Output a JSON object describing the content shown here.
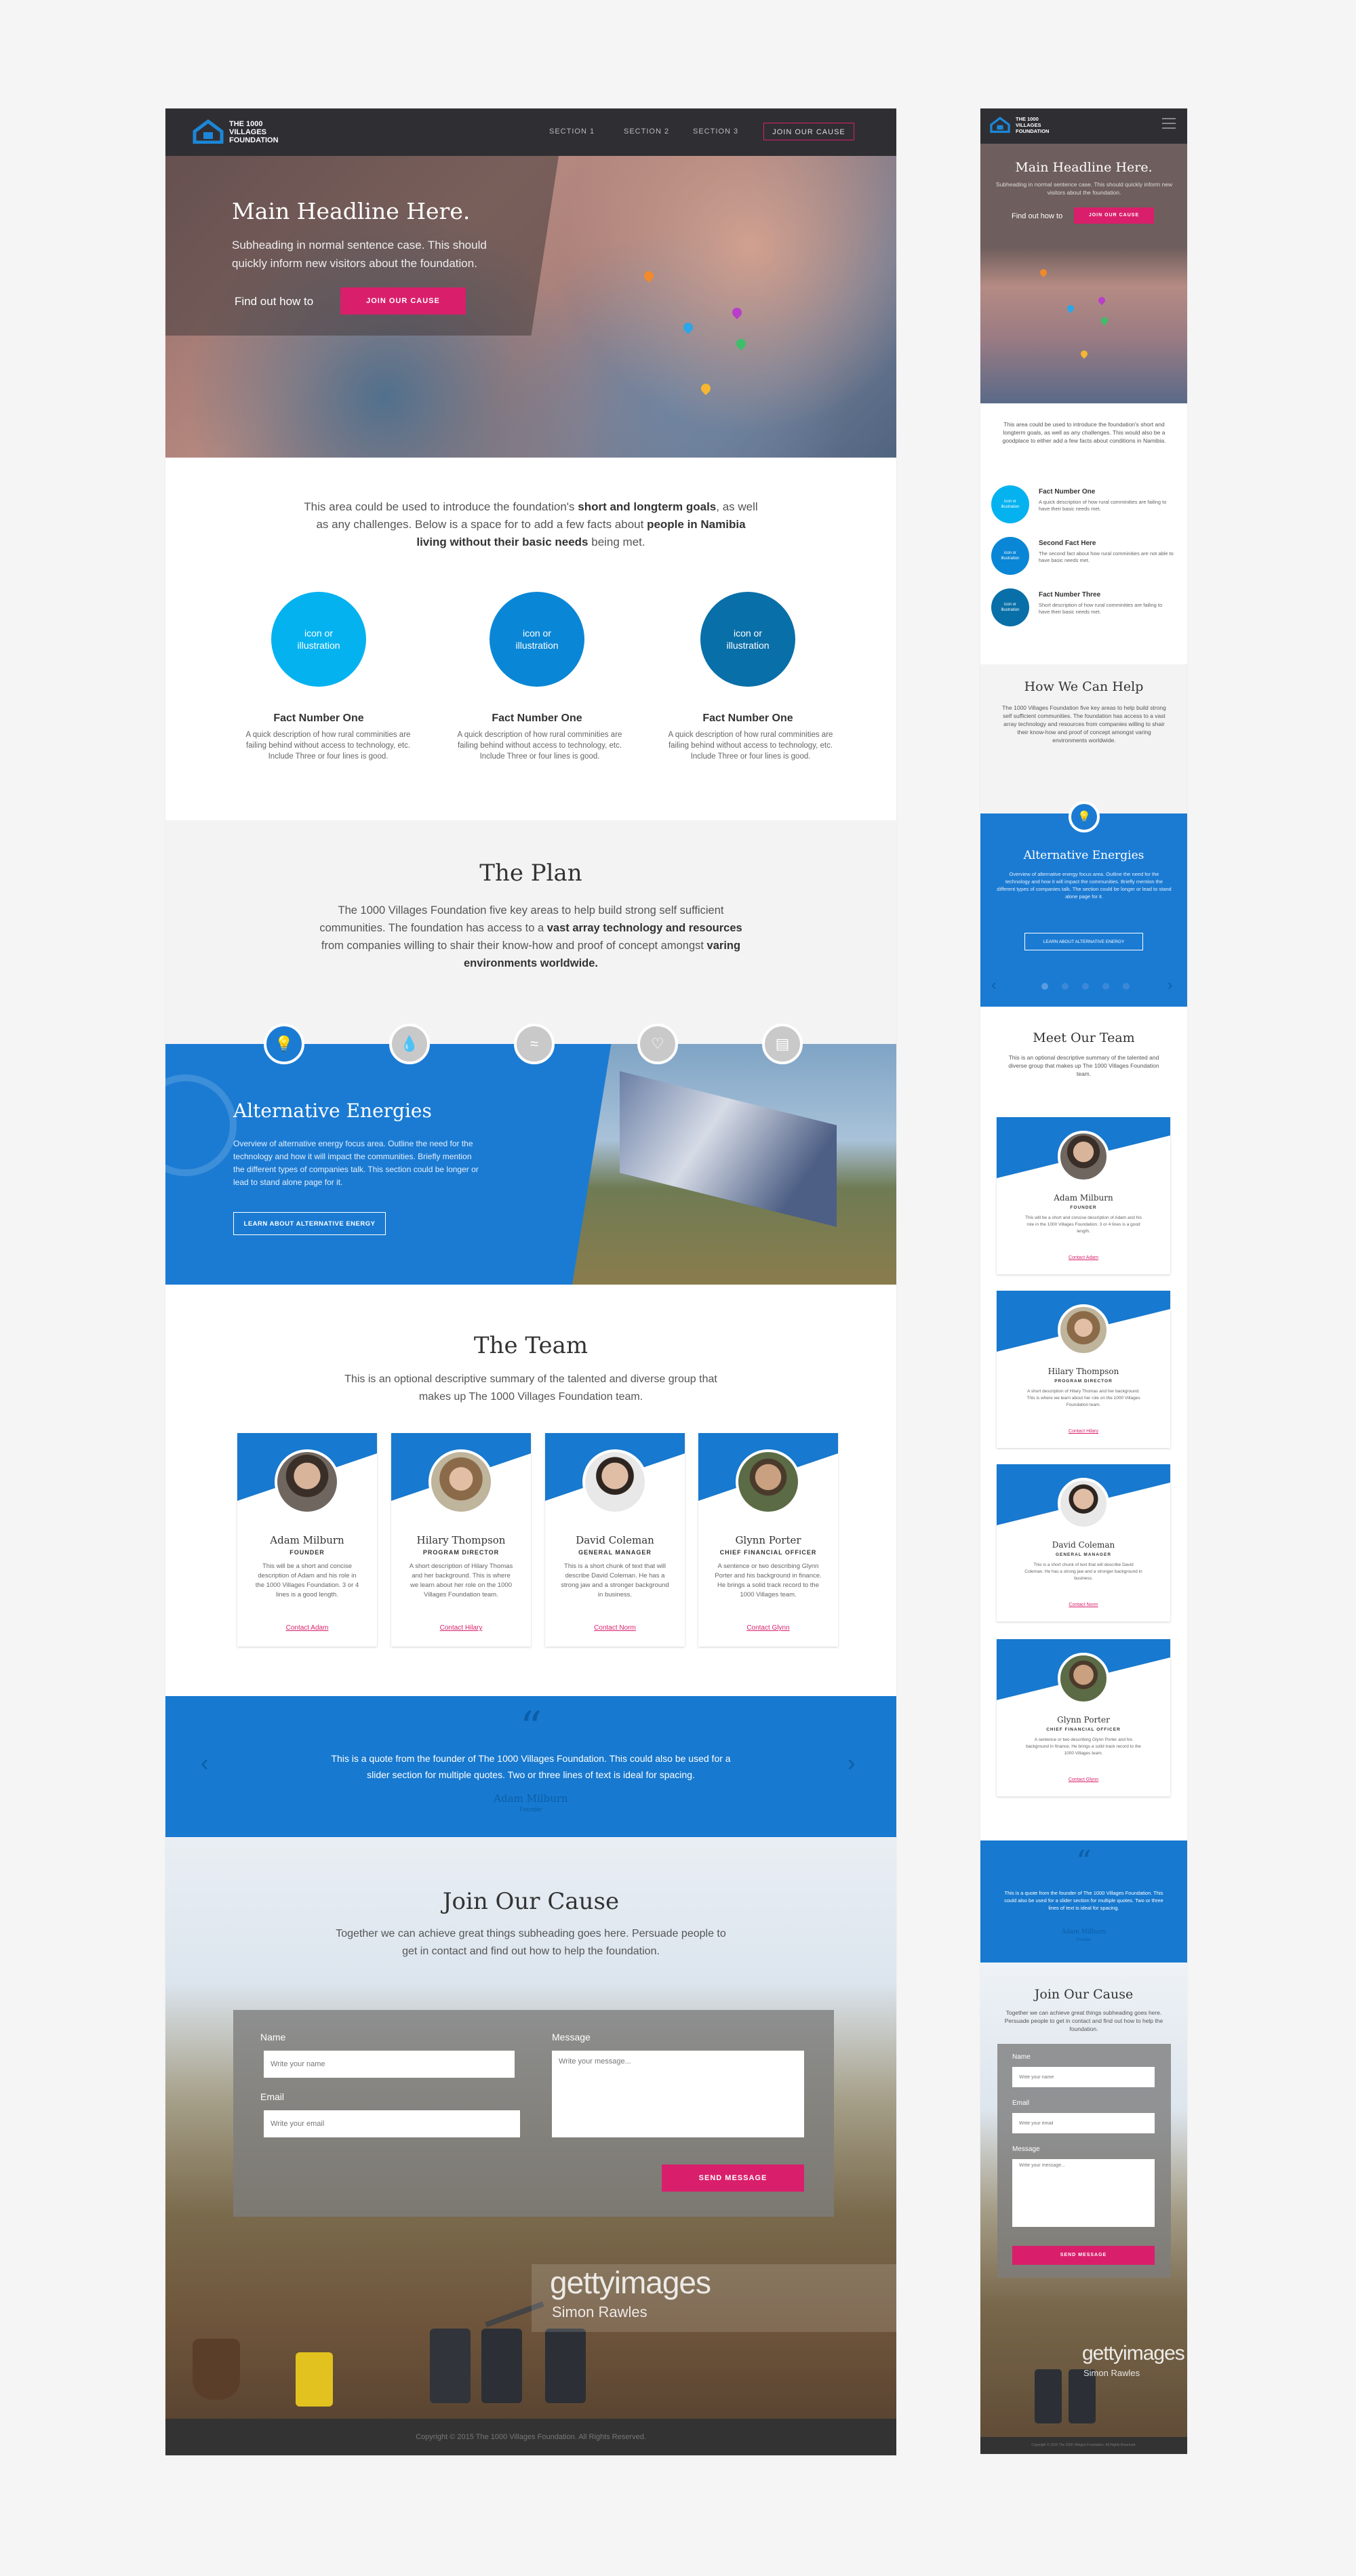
{
  "desktop": {
    "nav": {
      "logo_line1": "THE 1000",
      "logo_line2": "VILLAGES",
      "logo_line3": "FOUNDATION",
      "links": [
        "SECTION 1",
        "SECTION 2",
        "SECTION 3"
      ],
      "cta": "JOIN OUR CAUSE"
    },
    "hero": {
      "headline": "Main Headline Here.",
      "subheading": "Subheading in normal sentence case. This should quickly inform new visitors about the foundation.",
      "find_out": "Find out how to",
      "cta": "JOIN OUR CAUSE"
    },
    "intro": {
      "p1": "This area could be used to introduce the foundation's ",
      "b1": "short and longterm goals",
      "p2": ", as well as any challenges. Below is a space for to add a few facts about ",
      "b2": "people in Namibia living without their basic needs",
      "p3": " being met."
    },
    "facts": [
      {
        "icon": "icon or illustration",
        "title": "Fact Number One",
        "desc": "A quick description of how rural comminities are failing behind without access to technology, etc. Include Three or four lines is good.",
        "color": "#05b2f0"
      },
      {
        "icon": "icon or illustration",
        "title": "Fact Number One",
        "desc": "A quick description of how rural comminities are failing behind without access to technology, etc. Include Three or four lines is good.",
        "color": "#0a86d6"
      },
      {
        "icon": "icon or illustration",
        "title": "Fact Number One",
        "desc": "A quick description of how rural comminities are failing behind without access to technology, etc. Include Three or four lines is good.",
        "color": "#096fa8"
      }
    ],
    "plan": {
      "title": "The Plan",
      "p1": "The 1000 Villages Foundation five key areas to help build strong self sufficient communities. The foundation has access to a ",
      "b1": "vast array technology and resources",
      "p2": " from companies willing to shair their know-how and proof of concept amongst ",
      "b2": "varing environments worldwide."
    },
    "alt_energy": {
      "title": "Alternative Energies",
      "desc": "Overview of alternative energy focus area. Outline the need for the technology and how it will impact the communities. Briefly mention the different types of companies talk. This section could be longer or lead to stand alone page for it.",
      "button": "LEARN ABOUT ALTERNATIVE ENERGY"
    },
    "team": {
      "title": "The Team",
      "subtitle": "This is an optional descriptive summary of the talented and diverse group that makes up The 1000 Villages Foundation team.",
      "members": [
        {
          "name": "Adam Milburn",
          "role": "FOUNDER",
          "desc": "This will be a short and concise description of Adam and his role in the 1000 Villages Foundation. 3 or 4 lines is a good length.",
          "link": "Contact Adam"
        },
        {
          "name": "Hilary Thompson",
          "role": "PROGRAM DIRECTOR",
          "desc": "A short description of Hilary Thomas and her background. This is where we learn about her role on the 1000 Villages Foundation team.",
          "link": "Contact Hilary"
        },
        {
          "name": "David Coleman",
          "role": "GENERAL MANAGER",
          "desc": "This is a short chunk of text that will describe David Coleman. He has a strong jaw and a stronger background in business.",
          "link": "Contact Norm"
        },
        {
          "name": "Glynn Porter",
          "role": "CHIEF FINANCIAL OFFICER",
          "desc": "A sentence or two describing Glynn Porter and his background in finance. He brings a solid track record to the 1000 Villages team.",
          "link": "Contact Glynn"
        }
      ]
    },
    "quote": {
      "mark": "“",
      "text": "This is a quote from the founder of The 1000 Villages Foundation. This could also be used for a slider section for multiple quotes. Two or three lines of text is ideal for spacing.",
      "author": "Adam Milburn",
      "role": "Founder"
    },
    "join": {
      "title": "Join Our Cause",
      "subtitle": "Together we can achieve great things subheading goes here. Persuade people to get in contact and find out how to help the foundation.",
      "name_label": "Name",
      "name_placeholder": "Write your name",
      "email_label": "Email",
      "email_placeholder": "Write your email",
      "message_label": "Message",
      "message_placeholder": "Write your message...",
      "send": "SEND MESSAGE",
      "watermark": "gettyimages",
      "watermark_credit": "Simon Rawles"
    },
    "footer": "Copyright © 2015 The 1000 Villages Foundation. All Rights Reserved."
  },
  "mobile": {
    "logo_line1": "THE 1000",
    "logo_line2": "VILLAGES",
    "logo_line3": "FOUNDATION",
    "hero": {
      "headline": "Main Headline Here.",
      "subheading": "Subheading in normal sentence case. This should quickly inform new visitors about the foundation.",
      "find_out": "Find out how to",
      "cta": "JOIN OUR CAUSE"
    },
    "intro": "This area could be used to introduce the foundation's short and longterm goals, as well as any challenges. This would also be a goodplace to either add a few facts about conditions in Namibia.",
    "facts": [
      {
        "icon": "icon or illustration",
        "title": "Fact Number One",
        "desc": "A quick description of how rural comminities are failing to have their basic needs met."
      },
      {
        "icon": "icon or illustration",
        "title": "Second Fact Here",
        "desc": "The second fact about how rural comminities are not able to have basic needs met."
      },
      {
        "icon": "icon or illustration",
        "title": "Fact Number Three",
        "desc": "Short description of how rural comminities are failing to have their basic needs met."
      }
    ],
    "help": {
      "title": "How We Can Help",
      "text": "The 1000 Villages Foundation five key areas to help build strong self sufficient communities. The foundation has access to a vast array technology and resources from companies willing to shair their know-how and proof of concept amongst varing environments worldwide."
    },
    "alt": {
      "title": "Alternative Energies",
      "desc": "Overview of alternative energy focus area. Outline the need for the technology and how it will impact the communities. Briefly mention the different types of companies talk. The section could be longer or lead to stand alone page for it.",
      "button": "LEARN ABOUT ALTERNATIVE ENERGY"
    },
    "team": {
      "title": "Meet Our Team",
      "subtitle": "This is an optional descriptive summary of the talented and diverse group that makes up The 1000 Villages Foundation team.",
      "members": [
        {
          "name": "Adam Milburn",
          "role": "FOUNDER",
          "desc": "This will be a short and concise description of Adam and his role in the 1000 Villages Foundation. 3 or 4 lines is a good length.",
          "link": "Contact Adam"
        },
        {
          "name": "Hilary Thompson",
          "role": "PROGRAM DIRECTOR",
          "desc": "A short description of Hilary Thomas and her background. This is where we learn about her role on the 1000 Villages Foundation team.",
          "link": "Contact Hilary"
        },
        {
          "name": "David Coleman",
          "role": "GENERAL MANAGER",
          "desc": "This is a short chunk of text that will describe David Coleman. He has a strong jaw and a stronger background in business.",
          "link": "Contact Norm"
        },
        {
          "name": "Glynn Porter",
          "role": "CHIEF FINANCIAL OFFICER",
          "desc": "A sentence or two describing Glynn Porter and his background in finance. He brings a solid track record to the 1000 Villages team.",
          "link": "Contact Glynn"
        }
      ]
    },
    "quote": {
      "mark": "“",
      "text": "This is a quote from the founder of The 1000 Villages Foundation. This could also be used for a slider section for multiple quotes. Two or three lines of text is ideal for spacing.",
      "author": "Adam Milburn",
      "role": "Founder"
    },
    "join": {
      "title": "Join Our Cause",
      "subtitle": "Together we can achieve great things subheading goes here. Persuade people to get in contact and find out how to help the foundation.",
      "name_label": "Name",
      "name_placeholder": "Write your name",
      "email_label": "Email",
      "email_placeholder": "Write your email",
      "message_label": "Message",
      "message_placeholder": "Write your message...",
      "send": "SEND MESSAGE",
      "watermark": "gettyimages",
      "watermark_credit": "Simon Rawles"
    },
    "footer": "Copyright © 2015 The 1000 Villages Foundation. All Rights Reserved."
  },
  "colors": {
    "brand_blue": "#1779cf",
    "accent_pink": "#d91f6b",
    "nav_dark": "#2f2f33"
  }
}
